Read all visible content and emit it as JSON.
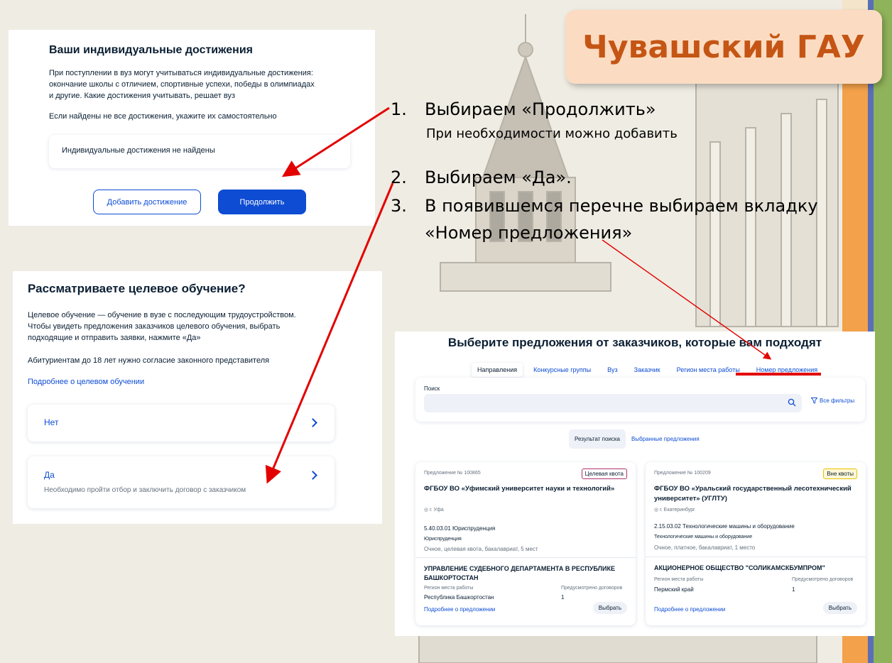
{
  "header": {
    "title": "Чувашский ГАУ"
  },
  "instructions": {
    "items": [
      {
        "num": "1.",
        "text": "Выбираем «Продолжить»",
        "sub": "При необходимости можно добавить"
      },
      {
        "num": "2.",
        "text": "Выбираем «Да»."
      },
      {
        "num": "3.",
        "text": "В появившемся перечне выбираем вкладку",
        "text2": "«Номер предложения»"
      }
    ]
  },
  "achievements": {
    "title": "Ваши индивидуальные достижения",
    "description_lines": [
      "При поступлении в вуз могут учитываться индивидуальные достижения:",
      "окончание школы с отличием, спортивные успехи, победы в олимпиадах",
      "и другие. Какие достижения учитывать, решает вуз"
    ],
    "hint": "Если найдены не все достижения, укажите их самостоятельно",
    "empty_state": "Индивидуальные достижения не найдены",
    "add_button": "Добавить достижение",
    "continue_button": "Продолжить"
  },
  "target_training": {
    "title": "Рассматриваете целевое обучение?",
    "description_lines": [
      "Целевое обучение — обучение в вузе с последующим трудоустройством.",
      "Чтобы увидеть предложения заказчиков целевого обучения, выбрать",
      "подходящие и отправить заявки, нажмите «Да»"
    ],
    "age_note": "Абитуриентам до 18 лет нужно согласие законного представителя",
    "more_link": "Подробнее о целевом обучении",
    "option_no": "Нет",
    "option_yes": "Да",
    "option_yes_sub": "Необходимо пройти отбор и заключить договор с заказчиком"
  },
  "offers": {
    "title": "Выберите предложения от заказчиков, которые вам подходят",
    "tabs": [
      "Направления",
      "Конкурсные группы",
      "Вуз",
      "Заказчик",
      "Регион места работы",
      "Номер предложения"
    ],
    "search_label": "Поиск",
    "filters_label": "Все фильтры",
    "toggle_results": "Результат поиска",
    "toggle_selected": "Выбранные предложения",
    "cards": [
      {
        "number": "Предложение № 100865",
        "badge": "Целевая квота",
        "badge_color": "#b0316e",
        "org": "ФГБОУ ВО «Уфимский университет науки и технологий»",
        "city": "г. Уфа",
        "program": "5.40.03.01 Юриспруденция",
        "profile": "Юриспруденция",
        "form": "Очное, целевая квота, бакалавриат, 5 мест",
        "employer": "УПРАВЛЕНИЕ СУДЕБНОГО ДЕПАРТАМЕНТА В РЕСПУБЛИКЕ БАШКОРТОСТАН",
        "region_label": "Регион места работы",
        "region": "Республика Башкортостан",
        "contracts_label": "Предусмотрено договоров",
        "contracts": "1",
        "details_link": "Подробнее о предложении",
        "select_button": "Выбрать"
      },
      {
        "number": "Предложение № 100209",
        "badge": "Вне квоты",
        "badge_color": "#c9a600",
        "org": "ФГБОУ ВО «Уральский государственный лесотехнический университет» (УГЛТУ)",
        "city": "г. Екатеринбург",
        "program": "2.15.03.02 Технологические машины и оборудование",
        "profile": "Технологические машины и оборудование",
        "form": "Очное, платное, бакалавриат, 1 место",
        "employer": "АКЦИОНЕРНОЕ ОБЩЕСТВО \"СОЛИКАМСКБУМПРОМ\"",
        "region_label": "Регион места работы",
        "region": "Пермский край",
        "contracts_label": "Предусмотрено договоров",
        "contracts": "1",
        "details_link": "Подробнее о предложении",
        "select_button": "Выбрать"
      }
    ]
  },
  "colors": {
    "accent": "#0d4cd3",
    "arrow": "#e30000",
    "brand": "#c55514"
  }
}
